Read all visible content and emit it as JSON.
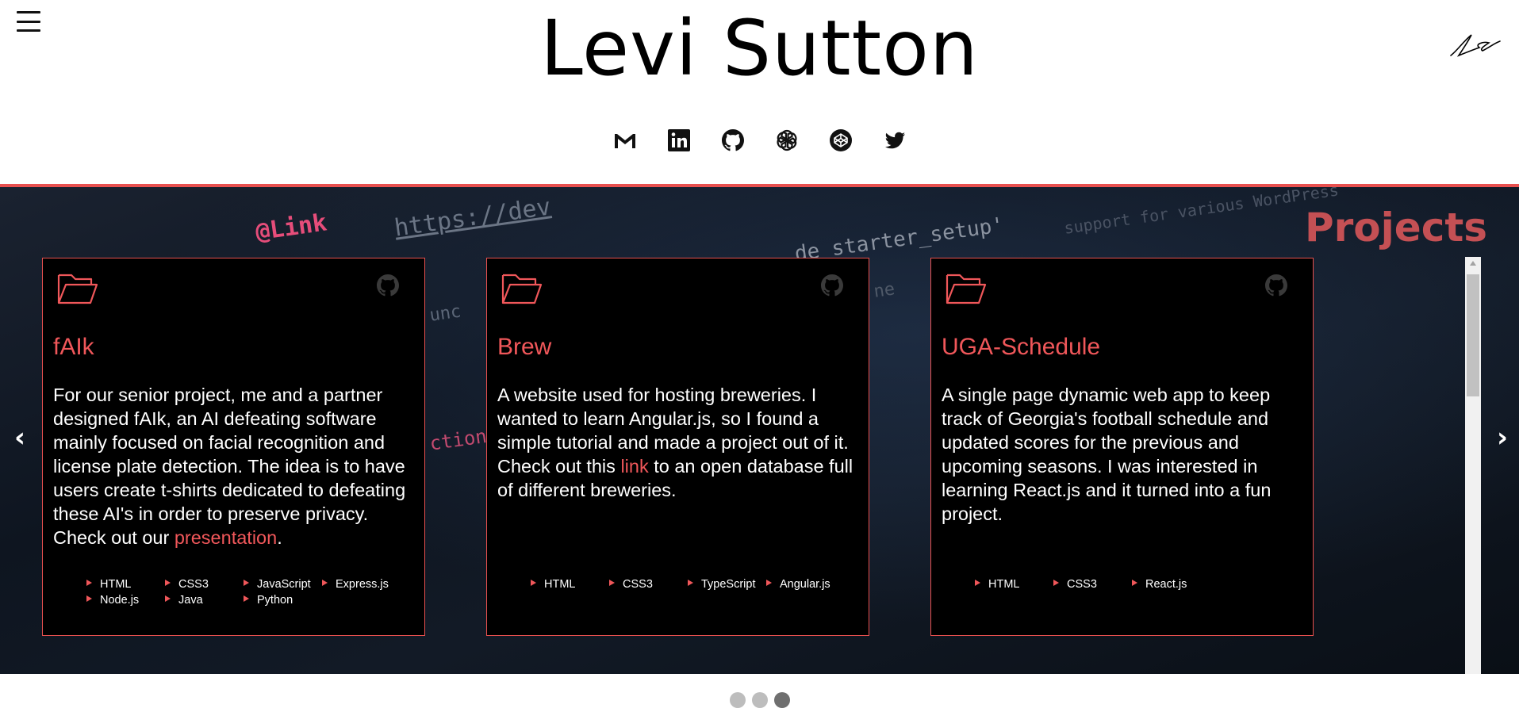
{
  "header": {
    "title": "Levi Sutton",
    "menu_icon": "hamburger-menu-icon",
    "signature_icon": "signature-logo-icon",
    "socials": [
      {
        "name": "email",
        "icon": "gmail-icon"
      },
      {
        "name": "linkedin",
        "icon": "linkedin-icon"
      },
      {
        "name": "github",
        "icon": "github-icon"
      },
      {
        "name": "openai",
        "icon": "openai-icon"
      },
      {
        "name": "codepen",
        "icon": "codepen-icon"
      },
      {
        "name": "twitter",
        "icon": "twitter-icon"
      }
    ]
  },
  "projects": {
    "title": "Projects",
    "prev_label": "‹",
    "next_label": "›",
    "cards": [
      {
        "name": "fAIk",
        "desc_before": "For our senior project, me and a partner designed fAIk, an AI defeating software mainly focused on facial recognition and license plate detection. The idea is to have users create t-shirts dedicated to defeating these AI's in order to preserve privacy. Check out our ",
        "link_text": "presentation",
        "desc_after": ".",
        "tags": [
          "HTML",
          "CSS3",
          "JavaScript",
          "Express.js",
          "Node.js",
          "Java",
          "Python"
        ]
      },
      {
        "name": "Brew",
        "desc_before": "A website used for hosting breweries. I wanted to learn Angular.js, so I found a simple tutorial and made a project out of it. Check out this ",
        "link_text": "link",
        "desc_after": " to an open database full of different breweries.",
        "tags": [
          "HTML",
          "CSS3",
          "TypeScript",
          "Angular.js"
        ]
      },
      {
        "name": "UGA-Schedule",
        "desc_before": "A single page dynamic web app to keep track of Georgia's football schedule and updated scores for the previous and upcoming seasons. I was interested in learning React.js and it turned into a fun project.",
        "link_text": "",
        "desc_after": "",
        "tags": [
          "HTML",
          "CSS3",
          "React.js"
        ]
      }
    ],
    "background_code": [
      "@Link",
      "https://dev",
      "de_starter_setup'",
      "support for various WordPress",
      "unc",
      "ne",
      "ction"
    ]
  },
  "pagination": {
    "count": 3,
    "active_index": 2
  },
  "colors": {
    "accent": "#e8504f",
    "section_title": "#c45054",
    "card_bg": "#000000"
  }
}
